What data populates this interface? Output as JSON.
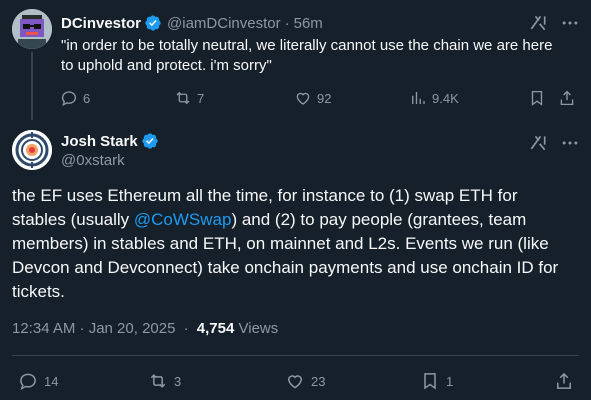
{
  "parent_tweet": {
    "author_name": "DCinvestor",
    "handle": "@iamDCinvestor",
    "separator": "·",
    "time": "56m",
    "text": "\"in order to be totally neutral, we literally cannot use the chain we are here to uphold and protect. i'm sorry\"",
    "actions": {
      "replies": "6",
      "reposts": "7",
      "likes": "92",
      "views": "9.4K"
    }
  },
  "main_tweet": {
    "author_name": "Josh Stark",
    "handle": "@0xstark",
    "text_part1": "the EF uses Ethereum all the time, for instance to (1) swap ETH for stables (usually ",
    "mention": "@CoWSwap",
    "text_part2": ") and (2) to pay people (grantees, team members) in stables and ETH, on mainnet and L2s. Events we run (like Devcon and Devconnect) take onchain payments and use onchain ID for tickets.",
    "timestamp": "12:34 AM · Jan 20, 2025",
    "meta_separator": "·",
    "views_count": "4,754",
    "views_label": "Views",
    "actions": {
      "replies": "14",
      "reposts": "3",
      "likes": "23",
      "bookmarks": "1"
    }
  },
  "colors": {
    "background": "#15202b",
    "text": "#f7f9f9",
    "muted": "#8b98a5",
    "accent": "#1d9bf0",
    "divider": "#38444d"
  },
  "icons": [
    "verified-badge-icon",
    "grok-icon",
    "more-icon",
    "reply-icon",
    "repost-icon",
    "like-icon",
    "views-icon",
    "bookmark-icon",
    "share-icon"
  ]
}
